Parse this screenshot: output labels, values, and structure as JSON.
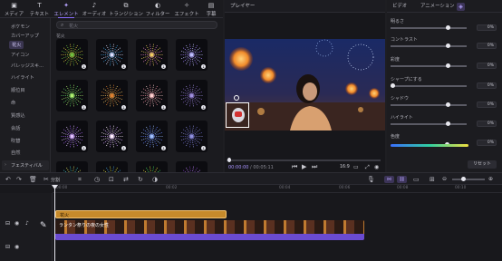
{
  "tabs": [
    {
      "label": "メディア",
      "icon": "media-icon"
    },
    {
      "label": "テキスト",
      "icon": "text-icon"
    },
    {
      "label": "エレメント",
      "icon": "element-icon",
      "active": true
    },
    {
      "label": "オーディオ",
      "icon": "audio-icon"
    },
    {
      "label": "トランジション",
      "icon": "transition-icon"
    },
    {
      "label": "フィルター",
      "icon": "filter-icon"
    },
    {
      "label": "エフェクト",
      "icon": "effect-icon"
    },
    {
      "label": "字幕",
      "icon": "caption-icon"
    }
  ],
  "categories": [
    "ボケモン",
    "カバーアップ",
    "花火",
    "アイコン",
    "バレッジスキ...",
    "ハイライト",
    "順位目",
    "命",
    "質感込",
    "会話",
    "吹替",
    "自然"
  ],
  "active_category": "花火",
  "category_footer": "フェスティバル",
  "search": {
    "placeholder": "花火"
  },
  "grid_label": "花火",
  "player": {
    "title": "プレイヤー",
    "current_time": "00:00:00",
    "total_time": "00:05:11",
    "ratio": "16:9"
  },
  "right_panel": {
    "tabs": [
      "ビデオ",
      "アニメーション"
    ],
    "params": [
      {
        "label": "明るさ",
        "value": "0%"
      },
      {
        "label": "コントラスト",
        "value": "0%"
      },
      {
        "label": "彩度",
        "value": "0%"
      },
      {
        "label": "シャープにする",
        "value": "0%"
      },
      {
        "label": "シャドウ",
        "value": "0%"
      },
      {
        "label": "ハイライト",
        "value": "0%"
      },
      {
        "label": "色度",
        "value": "0%"
      }
    ],
    "reset_label": "リセット"
  },
  "timeline": {
    "split_label": "分割",
    "ruler": [
      "00:00",
      "00:02",
      "00:04",
      "00:06",
      "00:08",
      "00:10"
    ],
    "text_clip": "花火",
    "video_clip": "ランタン祭りの夜の女性"
  },
  "colors": {
    "accent": "#8a6dff",
    "clip_text": "#c68a2b",
    "clip_video": "#6a4bd0"
  }
}
